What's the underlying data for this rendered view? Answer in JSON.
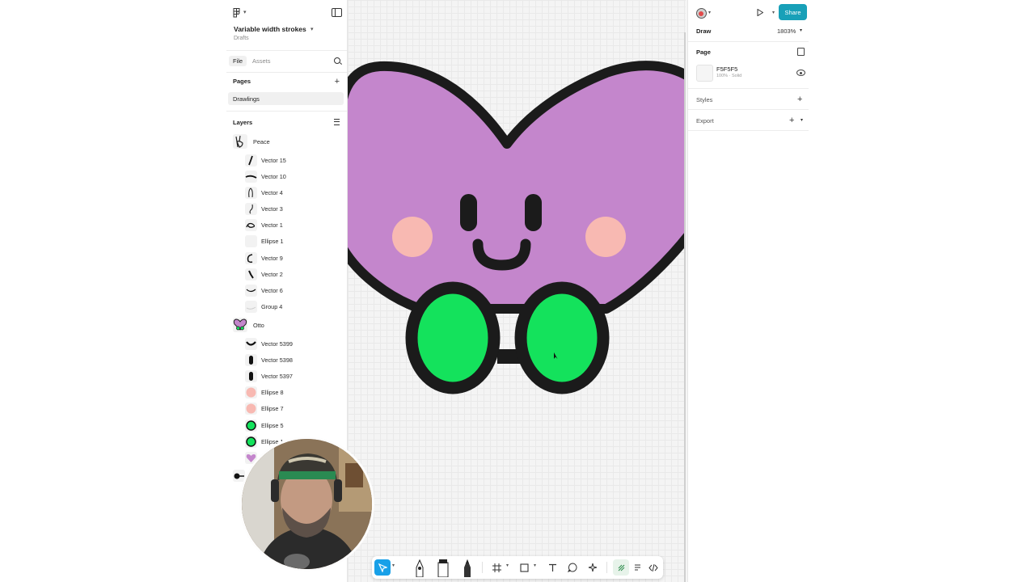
{
  "file": {
    "title": "Variable width strokes",
    "subtitle": "Drafts"
  },
  "left_tabs": {
    "file": "File",
    "assets": "Assets"
  },
  "pages": {
    "title": "Pages",
    "items": [
      {
        "label": "Drawlings"
      }
    ]
  },
  "layers": {
    "title": "Layers",
    "groups": [
      {
        "label": "Peace",
        "children": [
          "Vector 15",
          "Vector 10",
          "Vector 4",
          "Vector 3",
          "Vector 1",
          "Ellipse 1",
          "Vector 9",
          "Vector 2",
          "Vector 6",
          "Group 4"
        ]
      },
      {
        "label": "Otto",
        "children": [
          "Vector 5399",
          "Vector 5398",
          "Vector 5397",
          "Ellipse 8",
          "Ellipse 7",
          "Ellipse 5",
          "Ellipse 1"
        ]
      }
    ]
  },
  "right_panel": {
    "share": "Share",
    "draw": {
      "label": "Draw",
      "zoom": "1803%"
    },
    "page": {
      "label": "Page",
      "fill_hex": "F5F5F5",
      "fill_sub": "100% · Solid"
    },
    "styles": "Styles",
    "export": "Export"
  },
  "toolbar": {
    "tools": [
      "move-tool",
      "pen-tool",
      "marker-tool",
      "pencil-tool",
      "frame-tool",
      "shape-tool",
      "text-tool",
      "comment-tool",
      "actions-tool",
      "draw-mode",
      "design-mode",
      "dev-mode"
    ]
  },
  "colors": {
    "heart": "#c486cc",
    "outline": "#1b1b1b",
    "cheek": "#f8b9b2",
    "feet": "#14e25c",
    "accent": "#18a0b8",
    "selected_tool": "#18a0e8",
    "canvas_bg": "#F5F5F5"
  }
}
